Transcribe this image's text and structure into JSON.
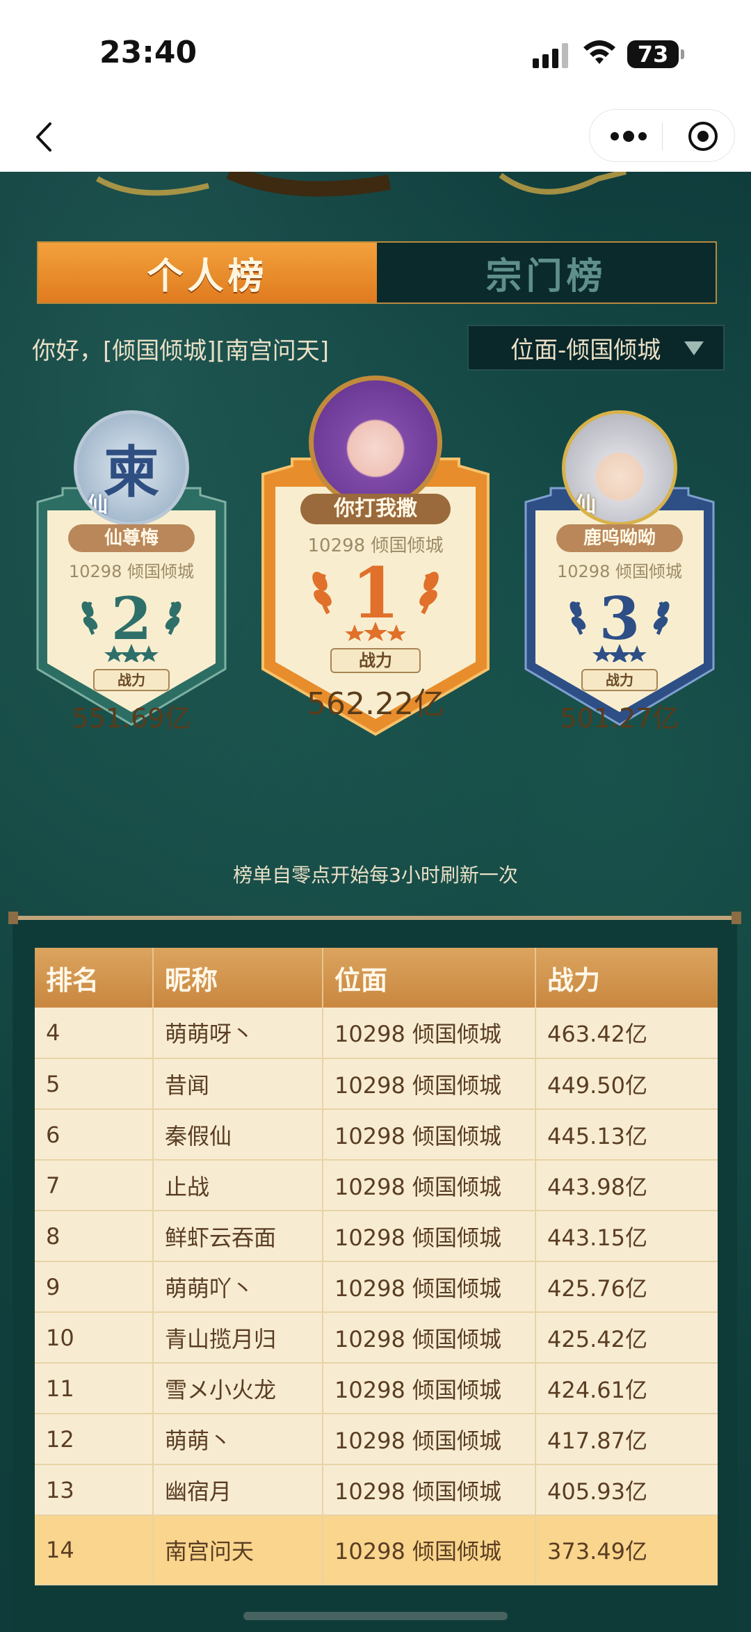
{
  "status_bar": {
    "time": "23:40",
    "battery": "73"
  },
  "tabs": [
    {
      "label": "个人榜",
      "active": true
    },
    {
      "label": "宗门榜",
      "active": false
    }
  ],
  "greeting": "你好，[倾国倾城][南宫问天]",
  "realm_select": {
    "value": "位面-倾国倾城"
  },
  "podium": {
    "first": {
      "rank": "1",
      "name": "你打我撒",
      "realm": "10298 倾国倾城",
      "power_label": "战力",
      "power": "562.22亿"
    },
    "second": {
      "rank": "2",
      "name": "仙尊悔",
      "realm": "10298 倾国倾城",
      "power_label": "战力",
      "power": "551.69亿",
      "avatar_glyph": "柬",
      "avatar_badge": "仙"
    },
    "third": {
      "rank": "3",
      "name": "鹿呜呦呦",
      "realm": "10298 倾国倾城",
      "power_label": "战力",
      "power": "501.27亿",
      "avatar_badge": "仙"
    }
  },
  "refresh_note": "榜单自零点开始每3小时刷新一次",
  "table": {
    "headers": [
      "排名",
      "昵称",
      "位面",
      "战力"
    ],
    "rows": [
      [
        "4",
        "萌萌呀丶",
        "10298 倾国倾城",
        "463.42亿"
      ],
      [
        "5",
        "昔闻",
        "10298 倾国倾城",
        "449.50亿"
      ],
      [
        "6",
        "秦假仙",
        "10298 倾国倾城",
        "445.13亿"
      ],
      [
        "7",
        "止战",
        "10298 倾国倾城",
        "443.98亿"
      ],
      [
        "8",
        "鲜虾云吞面",
        "10298 倾国倾城",
        "443.15亿"
      ],
      [
        "9",
        "萌萌吖丶",
        "10298 倾国倾城",
        "425.76亿"
      ],
      [
        "10",
        "青山揽月归",
        "10298 倾国倾城",
        "425.42亿"
      ],
      [
        "11",
        "雪メ小火龙",
        "10298 倾国倾城",
        "424.61亿"
      ],
      [
        "12",
        "萌萌丶",
        "10298 倾国倾城",
        "417.87亿"
      ],
      [
        "13",
        "幽宿月",
        "10298 倾国倾城",
        "405.93亿"
      ],
      [
        "14",
        "南宫问天",
        "10298 倾国倾城",
        "373.49亿"
      ]
    ]
  },
  "colors": {
    "accent_orange": "#e07b1f",
    "gold": "#c9873f",
    "teal_bg": "#0f3c3a",
    "self_row": "#f9d58d"
  }
}
